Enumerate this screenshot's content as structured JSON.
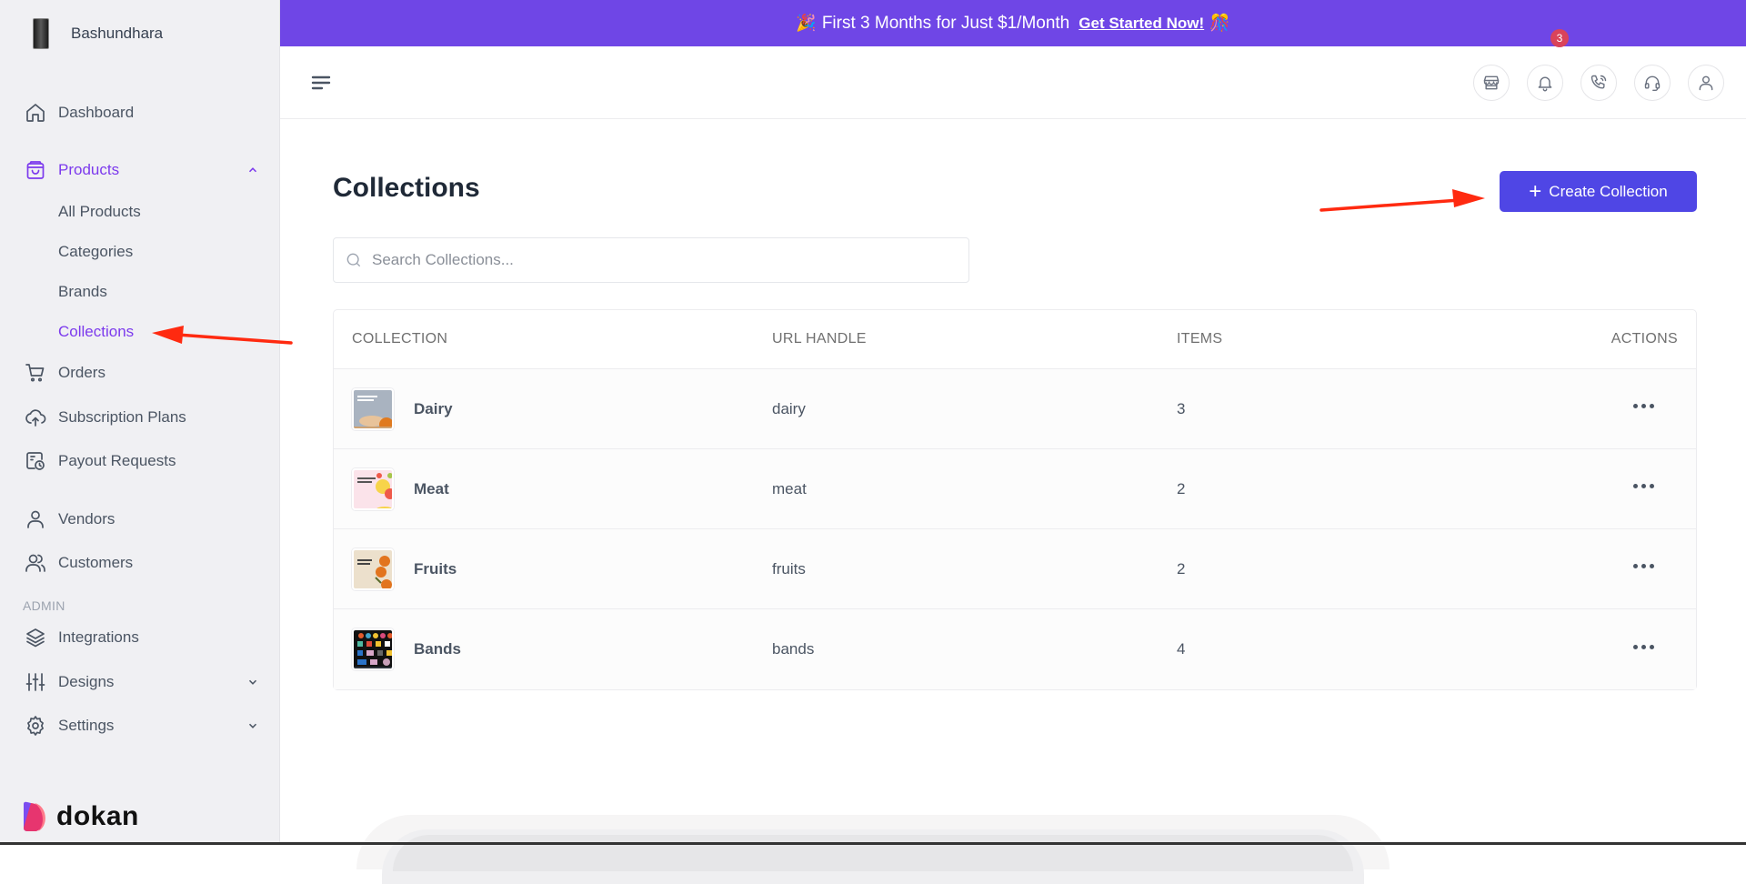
{
  "sidebar": {
    "store_name": "Bashundhara",
    "nav": {
      "dashboard": "Dashboard",
      "products": "Products",
      "products_sub": [
        "All Products",
        "Categories",
        "Brands",
        "Collections"
      ],
      "orders": "Orders",
      "subscription_plans": "Subscription Plans",
      "payout_requests": "Payout Requests",
      "vendors": "Vendors",
      "customers": "Customers",
      "admin_label": "ADMIN",
      "integrations": "Integrations",
      "designs": "Designs",
      "settings": "Settings"
    },
    "active_item": "Collections",
    "footer_brand": "dokan"
  },
  "banner": {
    "text": "First 3 Months for Just $1/Month",
    "link": "Get Started Now!",
    "emoji_left": "🎉",
    "emoji_right": "🎊"
  },
  "header": {
    "notification_count": "3",
    "icons": [
      "store-icon",
      "bell-icon",
      "phone-icon",
      "headset-icon",
      "user-icon"
    ]
  },
  "main": {
    "title": "Collections",
    "create_button": "Create Collection",
    "search_placeholder": "Search Collections...",
    "search_value": "",
    "table": {
      "columns": [
        "COLLECTION",
        "URL HANDLE",
        "ITEMS",
        "ACTIONS"
      ],
      "rows": [
        {
          "name": "Dairy",
          "handle": "dairy",
          "items": "3"
        },
        {
          "name": "Meat",
          "handle": "meat",
          "items": "2"
        },
        {
          "name": "Fruits",
          "handle": "fruits",
          "items": "2"
        },
        {
          "name": "Bands",
          "handle": "bands",
          "items": "4"
        }
      ]
    }
  },
  "colors": {
    "accent": "#7c3aed",
    "banner": "#6f46e6",
    "primary_button": "#4f46e5",
    "badge": "#d9435a",
    "annotation_arrow": "#ff2a10"
  }
}
